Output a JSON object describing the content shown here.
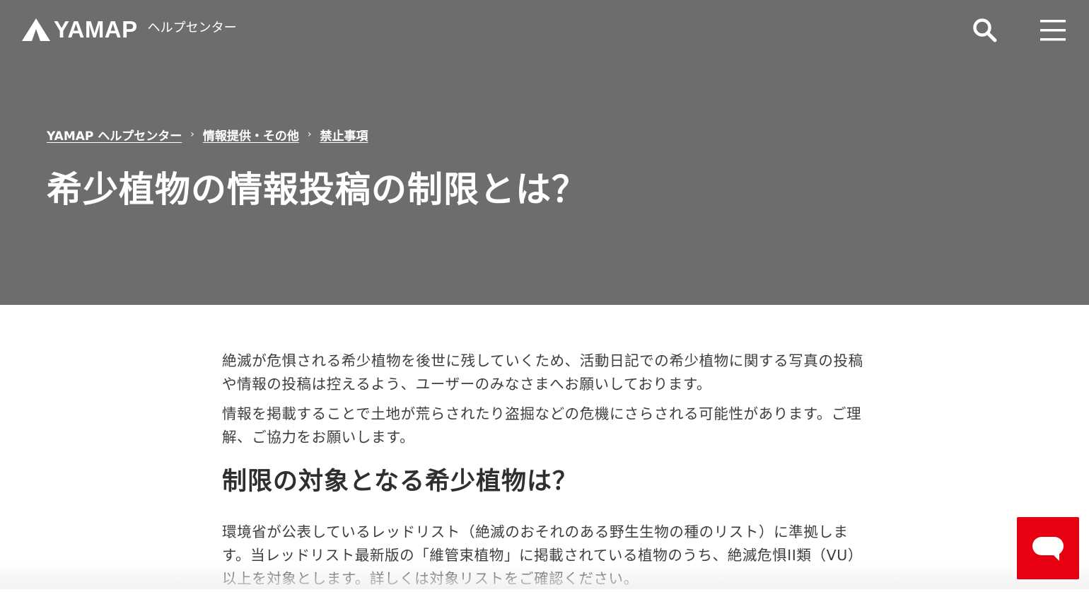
{
  "header": {
    "logo_text": "YAMAP",
    "logo_sub": "ヘルプセンター",
    "search_icon": "search-icon",
    "menu_icon": "hamburger-menu-icon"
  },
  "breadcrumb": {
    "items": [
      {
        "label": "YAMAP ヘルプセンター"
      },
      {
        "label": "情報提供・その他"
      },
      {
        "label": "禁止事項"
      }
    ],
    "separator": "›"
  },
  "hero": {
    "title": "希少植物の情報投稿の制限とは？",
    "background": "#6d6d6d"
  },
  "article": {
    "intro_1": "絶滅が危惧される希少植物を後世に残していくため、活動日記での希少植物に関する写真の投稿や情報の投稿は控えるよう、ユーザーのみなさまへお願いしております。",
    "intro_2": "情報を掲載することで土地が荒らされたり盗掘などの危機にさらされる可能性があります。ご理解、ご協力をお願いします。",
    "section_heading": "制限の対象となる希少植物は？",
    "section_body": "環境省が公表しているレッドリスト（絶滅のおそれのある野生生物の種のリスト）に準拠します。当レッドリスト最新版の「維管束植物」に掲載されている植物のうち、絶滅危惧II類（VU）以上を対象とします。詳しくは対象リストをご確認ください。"
  },
  "chat_button": {
    "icon": "chat-bubble-icon",
    "color": "#e60012"
  }
}
